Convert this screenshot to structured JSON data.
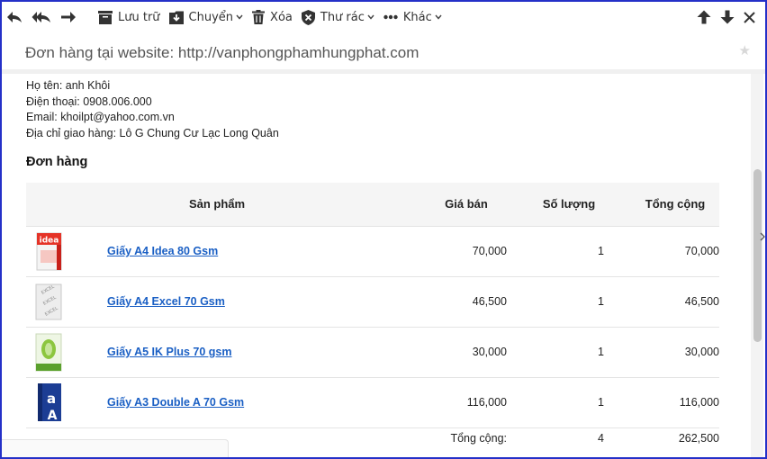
{
  "toolbar": {
    "archive_label": "Lưu trữ",
    "move_label": "Chuyển",
    "delete_label": "Xóa",
    "spam_label": "Thư rác",
    "more_label": "Khác"
  },
  "email": {
    "subject": "Đơn hàng tại website: http://vanphongphamhungphat.com",
    "star": "★"
  },
  "customer": {
    "name_line": "Họ tên: anh Khôi",
    "phone_line": "Điện thoại: 0908.006.000",
    "email_line": "Email: khoilpt@yahoo.com.vn",
    "address_line": "Địa chỉ giao hàng: Lô G Chung Cư Lạc Long Quân"
  },
  "order": {
    "title": "Đơn hàng",
    "headers": {
      "product": "Sản phẩm",
      "price": "Giá bán",
      "qty": "Số lượng",
      "total": "Tổng cộng"
    },
    "rows": [
      {
        "name": "Giấy A4 Idea 80 Gsm",
        "price": "70,000",
        "qty": "1",
        "total": "70,000",
        "thumb": "idea-paper-ream"
      },
      {
        "name": "Giấy A4 Excel 70 Gsm",
        "price": "46,500",
        "qty": "1",
        "total": "46,500",
        "thumb": "excel-paper-ream"
      },
      {
        "name": "Giấy A5 IK Plus 70 gsm",
        "price": "30,000",
        "qty": "1",
        "total": "30,000",
        "thumb": "ik-plus-paper-ream"
      },
      {
        "name": "Giấy A3 Double A 70 Gsm",
        "price": "116,000",
        "qty": "1",
        "total": "116,000",
        "thumb": "double-a-paper-ream"
      }
    ],
    "summary": {
      "label": "Tổng cộng:",
      "qty": "4",
      "total": "262,500"
    }
  },
  "colors": {
    "frame_border": "#2430c8",
    "link": "#1a5fc4",
    "header_bg": "#f5f5f5"
  }
}
